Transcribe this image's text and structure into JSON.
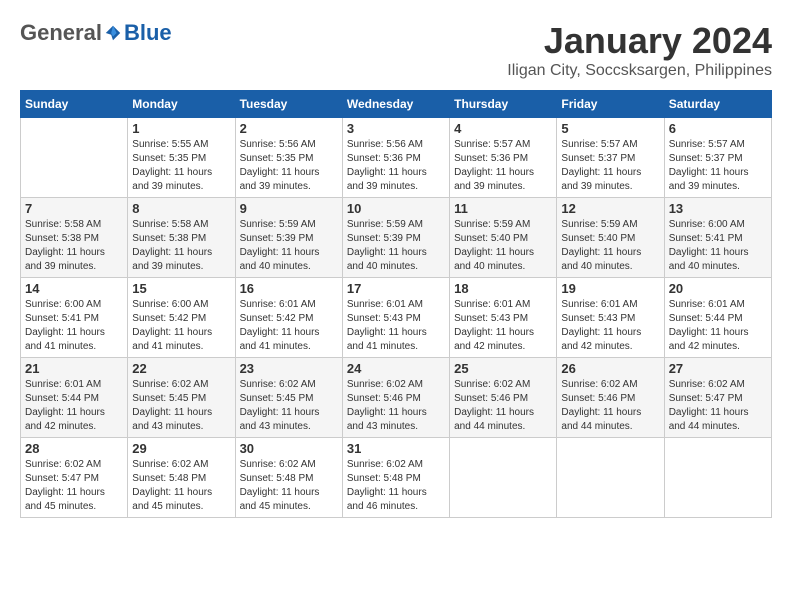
{
  "header": {
    "logo_general": "General",
    "logo_blue": "Blue",
    "month_title": "January 2024",
    "subtitle": "Iligan City, Soccsksargen, Philippines"
  },
  "days_of_week": [
    "Sunday",
    "Monday",
    "Tuesday",
    "Wednesday",
    "Thursday",
    "Friday",
    "Saturday"
  ],
  "weeks": [
    [
      {
        "day": "",
        "sunrise": "",
        "sunset": "",
        "daylight": ""
      },
      {
        "day": "1",
        "sunrise": "Sunrise: 5:55 AM",
        "sunset": "Sunset: 5:35 PM",
        "daylight": "Daylight: 11 hours and 39 minutes."
      },
      {
        "day": "2",
        "sunrise": "Sunrise: 5:56 AM",
        "sunset": "Sunset: 5:35 PM",
        "daylight": "Daylight: 11 hours and 39 minutes."
      },
      {
        "day": "3",
        "sunrise": "Sunrise: 5:56 AM",
        "sunset": "Sunset: 5:36 PM",
        "daylight": "Daylight: 11 hours and 39 minutes."
      },
      {
        "day": "4",
        "sunrise": "Sunrise: 5:57 AM",
        "sunset": "Sunset: 5:36 PM",
        "daylight": "Daylight: 11 hours and 39 minutes."
      },
      {
        "day": "5",
        "sunrise": "Sunrise: 5:57 AM",
        "sunset": "Sunset: 5:37 PM",
        "daylight": "Daylight: 11 hours and 39 minutes."
      },
      {
        "day": "6",
        "sunrise": "Sunrise: 5:57 AM",
        "sunset": "Sunset: 5:37 PM",
        "daylight": "Daylight: 11 hours and 39 minutes."
      }
    ],
    [
      {
        "day": "7",
        "sunrise": "Sunrise: 5:58 AM",
        "sunset": "Sunset: 5:38 PM",
        "daylight": "Daylight: 11 hours and 39 minutes."
      },
      {
        "day": "8",
        "sunrise": "Sunrise: 5:58 AM",
        "sunset": "Sunset: 5:38 PM",
        "daylight": "Daylight: 11 hours and 39 minutes."
      },
      {
        "day": "9",
        "sunrise": "Sunrise: 5:59 AM",
        "sunset": "Sunset: 5:39 PM",
        "daylight": "Daylight: 11 hours and 40 minutes."
      },
      {
        "day": "10",
        "sunrise": "Sunrise: 5:59 AM",
        "sunset": "Sunset: 5:39 PM",
        "daylight": "Daylight: 11 hours and 40 minutes."
      },
      {
        "day": "11",
        "sunrise": "Sunrise: 5:59 AM",
        "sunset": "Sunset: 5:40 PM",
        "daylight": "Daylight: 11 hours and 40 minutes."
      },
      {
        "day": "12",
        "sunrise": "Sunrise: 5:59 AM",
        "sunset": "Sunset: 5:40 PM",
        "daylight": "Daylight: 11 hours and 40 minutes."
      },
      {
        "day": "13",
        "sunrise": "Sunrise: 6:00 AM",
        "sunset": "Sunset: 5:41 PM",
        "daylight": "Daylight: 11 hours and 40 minutes."
      }
    ],
    [
      {
        "day": "14",
        "sunrise": "Sunrise: 6:00 AM",
        "sunset": "Sunset: 5:41 PM",
        "daylight": "Daylight: 11 hours and 41 minutes."
      },
      {
        "day": "15",
        "sunrise": "Sunrise: 6:00 AM",
        "sunset": "Sunset: 5:42 PM",
        "daylight": "Daylight: 11 hours and 41 minutes."
      },
      {
        "day": "16",
        "sunrise": "Sunrise: 6:01 AM",
        "sunset": "Sunset: 5:42 PM",
        "daylight": "Daylight: 11 hours and 41 minutes."
      },
      {
        "day": "17",
        "sunrise": "Sunrise: 6:01 AM",
        "sunset": "Sunset: 5:43 PM",
        "daylight": "Daylight: 11 hours and 41 minutes."
      },
      {
        "day": "18",
        "sunrise": "Sunrise: 6:01 AM",
        "sunset": "Sunset: 5:43 PM",
        "daylight": "Daylight: 11 hours and 42 minutes."
      },
      {
        "day": "19",
        "sunrise": "Sunrise: 6:01 AM",
        "sunset": "Sunset: 5:43 PM",
        "daylight": "Daylight: 11 hours and 42 minutes."
      },
      {
        "day": "20",
        "sunrise": "Sunrise: 6:01 AM",
        "sunset": "Sunset: 5:44 PM",
        "daylight": "Daylight: 11 hours and 42 minutes."
      }
    ],
    [
      {
        "day": "21",
        "sunrise": "Sunrise: 6:01 AM",
        "sunset": "Sunset: 5:44 PM",
        "daylight": "Daylight: 11 hours and 42 minutes."
      },
      {
        "day": "22",
        "sunrise": "Sunrise: 6:02 AM",
        "sunset": "Sunset: 5:45 PM",
        "daylight": "Daylight: 11 hours and 43 minutes."
      },
      {
        "day": "23",
        "sunrise": "Sunrise: 6:02 AM",
        "sunset": "Sunset: 5:45 PM",
        "daylight": "Daylight: 11 hours and 43 minutes."
      },
      {
        "day": "24",
        "sunrise": "Sunrise: 6:02 AM",
        "sunset": "Sunset: 5:46 PM",
        "daylight": "Daylight: 11 hours and 43 minutes."
      },
      {
        "day": "25",
        "sunrise": "Sunrise: 6:02 AM",
        "sunset": "Sunset: 5:46 PM",
        "daylight": "Daylight: 11 hours and 44 minutes."
      },
      {
        "day": "26",
        "sunrise": "Sunrise: 6:02 AM",
        "sunset": "Sunset: 5:46 PM",
        "daylight": "Daylight: 11 hours and 44 minutes."
      },
      {
        "day": "27",
        "sunrise": "Sunrise: 6:02 AM",
        "sunset": "Sunset: 5:47 PM",
        "daylight": "Daylight: 11 hours and 44 minutes."
      }
    ],
    [
      {
        "day": "28",
        "sunrise": "Sunrise: 6:02 AM",
        "sunset": "Sunset: 5:47 PM",
        "daylight": "Daylight: 11 hours and 45 minutes."
      },
      {
        "day": "29",
        "sunrise": "Sunrise: 6:02 AM",
        "sunset": "Sunset: 5:48 PM",
        "daylight": "Daylight: 11 hours and 45 minutes."
      },
      {
        "day": "30",
        "sunrise": "Sunrise: 6:02 AM",
        "sunset": "Sunset: 5:48 PM",
        "daylight": "Daylight: 11 hours and 45 minutes."
      },
      {
        "day": "31",
        "sunrise": "Sunrise: 6:02 AM",
        "sunset": "Sunset: 5:48 PM",
        "daylight": "Daylight: 11 hours and 46 minutes."
      },
      {
        "day": "",
        "sunrise": "",
        "sunset": "",
        "daylight": ""
      },
      {
        "day": "",
        "sunrise": "",
        "sunset": "",
        "daylight": ""
      },
      {
        "day": "",
        "sunrise": "",
        "sunset": "",
        "daylight": ""
      }
    ]
  ]
}
